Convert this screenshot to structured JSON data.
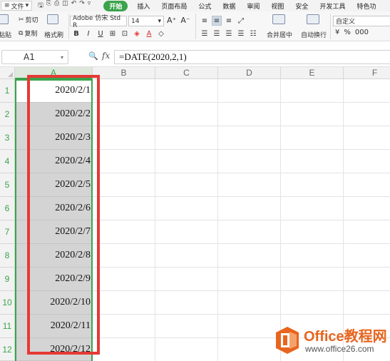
{
  "menubar": {
    "file_label": "文件",
    "tabs": [
      {
        "label": "开始",
        "active": true
      },
      {
        "label": "插入"
      },
      {
        "label": "页面布局"
      },
      {
        "label": "公式"
      },
      {
        "label": "数据"
      },
      {
        "label": "审阅"
      },
      {
        "label": "视图"
      },
      {
        "label": "安全"
      },
      {
        "label": "开发工具"
      },
      {
        "label": "特色功"
      }
    ],
    "accent_color": "#3aa34b"
  },
  "ribbon": {
    "paste_label": "粘贴",
    "cut_label": "剪切",
    "copy_label": "复制",
    "format_painter_label": "格式刷",
    "font_name": "Adobe 仿宋 Std R",
    "font_size": "14",
    "grow_font": "A⁺",
    "shrink_font": "A⁻",
    "bold": "B",
    "italic": "I",
    "underline": "U",
    "merge_center_label": "合并居中",
    "wrap_text_label": "自动换行",
    "number_format": "自定义",
    "percent": "%",
    "thousands": "000"
  },
  "formula_bar": {
    "name_box": "A1",
    "fx": "fx",
    "formula": "=DATE(2020,2,1)"
  },
  "sheet": {
    "columns": [
      "A",
      "B",
      "C",
      "D",
      "E",
      "F"
    ],
    "rows": [
      "1",
      "2",
      "3",
      "4",
      "5",
      "6",
      "7",
      "8",
      "9",
      "10",
      "11",
      "12"
    ],
    "column_a_values": [
      "2020/2/1",
      "2020/2/2",
      "2020/2/3",
      "2020/2/4",
      "2020/2/5",
      "2020/2/6",
      "2020/2/7",
      "2020/2/8",
      "2020/2/9",
      "2020/2/10",
      "2020/2/11",
      "2020/2/12"
    ],
    "selection_color": "#3aa34b",
    "highlight_color": "#e53935"
  },
  "watermark": {
    "title": "Office教程网",
    "url": "www.office26.com"
  }
}
